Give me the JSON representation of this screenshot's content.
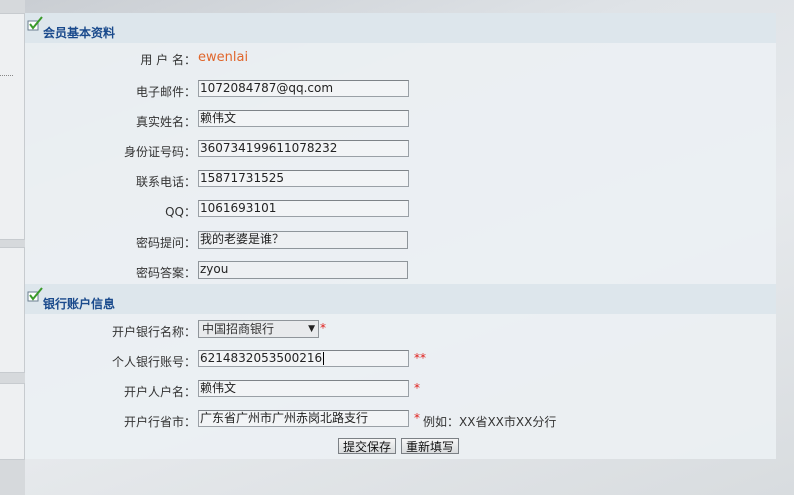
{
  "member_section": {
    "title": "会员基本资料",
    "username_label": "用 户 名：",
    "username_value": "ewenlai",
    "email_label": "电子邮件：",
    "email_value": "1072084787@qq.com",
    "realname_label": "真实姓名：",
    "realname_value": "赖伟文",
    "idcard_label": "身份证号码：",
    "idcard_value": "360734199611078232",
    "phone_label": "联系电话：",
    "phone_value": "15871731525",
    "qq_label": "QQ：",
    "qq_value": "1061693101",
    "question_label": "密码提问：",
    "question_value": "我的老婆是谁？",
    "answer_label": "密码答案：",
    "answer_value": "zyou"
  },
  "bank_section": {
    "title": "银行账户信息",
    "bank_name_label": "开户银行名称：",
    "bank_name_value": "中国招商银行",
    "bank_name_star": "*",
    "account_label": "个人银行账号：",
    "account_value": "6214832053500216",
    "account_star": "**",
    "holder_label": "开户人户名：",
    "holder_value": "赖伟文",
    "holder_star": "*",
    "branch_label": "开户行省市：",
    "branch_value": "广东省广州市广州赤岗北路支行",
    "branch_star": "*",
    "branch_hint": "例如：XX省XX市XX分行"
  },
  "buttons": {
    "submit": "提交保存",
    "reset": "重新填写"
  },
  "colors": {
    "section_title": "#1a4a8c",
    "username_link": "#e0662c",
    "required_star": "#e0201c"
  }
}
